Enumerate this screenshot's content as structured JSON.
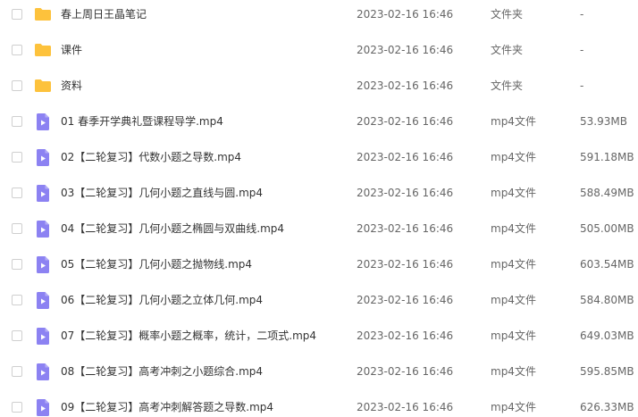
{
  "colors": {
    "folder_icon": "#fdc23c",
    "video_icon": "#8c82f2",
    "text": "#333333",
    "muted_text": "#666666"
  },
  "files": [
    {
      "icon": "folder-icon",
      "name": "春上周日王晶笔记",
      "modified": "2023-02-16 16:46",
      "type": "文件夹",
      "size": "-"
    },
    {
      "icon": "folder-icon",
      "name": "课件",
      "modified": "2023-02-16 16:46",
      "type": "文件夹",
      "size": "-"
    },
    {
      "icon": "folder-icon",
      "name": "资料",
      "modified": "2023-02-16 16:46",
      "type": "文件夹",
      "size": "-"
    },
    {
      "icon": "video-file-icon",
      "name": "01 春季开学典礼暨课程导学.mp4",
      "modified": "2023-02-16 16:46",
      "type": "mp4文件",
      "size": "53.93MB"
    },
    {
      "icon": "video-file-icon",
      "name": "02【二轮复习】代数小题之导数.mp4",
      "modified": "2023-02-16 16:46",
      "type": "mp4文件",
      "size": "591.18MB"
    },
    {
      "icon": "video-file-icon",
      "name": "03【二轮复习】几何小题之直线与圆.mp4",
      "modified": "2023-02-16 16:46",
      "type": "mp4文件",
      "size": "588.49MB"
    },
    {
      "icon": "video-file-icon",
      "name": "04【二轮复习】几何小题之椭圆与双曲线.mp4",
      "modified": "2023-02-16 16:46",
      "type": "mp4文件",
      "size": "505.00MB"
    },
    {
      "icon": "video-file-icon",
      "name": "05【二轮复习】几何小题之抛物线.mp4",
      "modified": "2023-02-16 16:46",
      "type": "mp4文件",
      "size": "603.54MB"
    },
    {
      "icon": "video-file-icon",
      "name": "06【二轮复习】几何小题之立体几何.mp4",
      "modified": "2023-02-16 16:46",
      "type": "mp4文件",
      "size": "584.80MB"
    },
    {
      "icon": "video-file-icon",
      "name": "07【二轮复习】概率小题之概率，统计，二项式.mp4",
      "modified": "2023-02-16 16:46",
      "type": "mp4文件",
      "size": "649.03MB"
    },
    {
      "icon": "video-file-icon",
      "name": "08【二轮复习】高考冲刺之小题综合.mp4",
      "modified": "2023-02-16 16:46",
      "type": "mp4文件",
      "size": "595.85MB"
    },
    {
      "icon": "video-file-icon",
      "name": "09【二轮复习】高考冲刺解答题之导数.mp4",
      "modified": "2023-02-16 16:46",
      "type": "mp4文件",
      "size": "626.33MB"
    }
  ]
}
